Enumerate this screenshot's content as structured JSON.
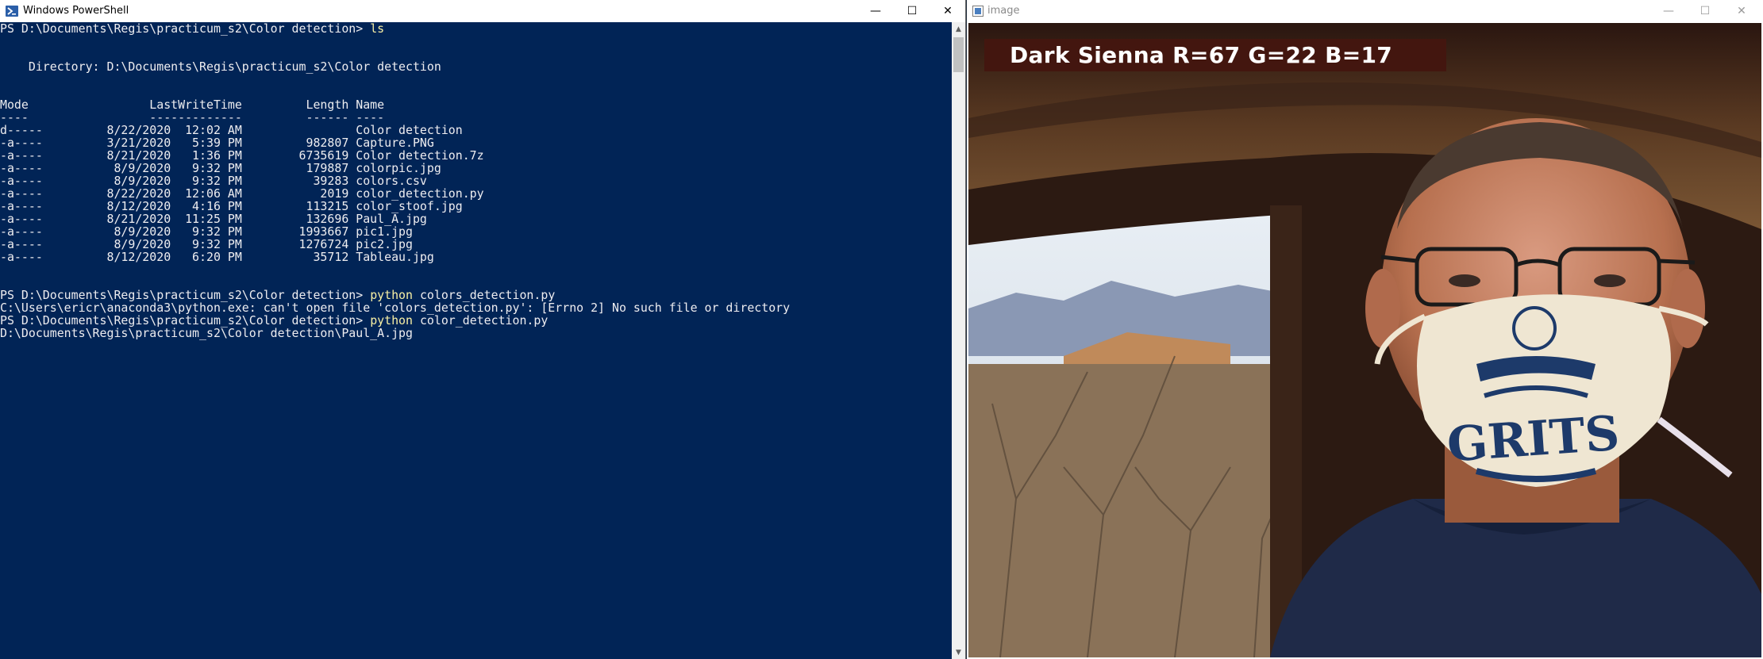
{
  "powershell": {
    "title": "Windows PowerShell",
    "lines": [
      {
        "prompt": "PS D:\\Documents\\Regis\\practicum_s2\\Color detection> ",
        "cmd": "ls",
        "rest": ""
      },
      {
        "text": ""
      },
      {
        "text": ""
      },
      {
        "text": "    Directory: D:\\Documents\\Regis\\practicum_s2\\Color detection"
      },
      {
        "text": ""
      },
      {
        "text": ""
      },
      {
        "text": "Mode                 LastWriteTime         Length Name"
      },
      {
        "text": "----                 -------------         ------ ----"
      },
      {
        "text": "d-----         8/22/2020  12:02 AM                Color detection"
      },
      {
        "text": "-a----         3/21/2020   5:39 PM         982807 Capture.PNG"
      },
      {
        "text": "-a----         8/21/2020   1:36 PM        6735619 Color detection.7z"
      },
      {
        "text": "-a----          8/9/2020   9:32 PM         179887 colorpic.jpg"
      },
      {
        "text": "-a----          8/9/2020   9:32 PM          39283 colors.csv"
      },
      {
        "text": "-a----         8/22/2020  12:06 AM           2019 color_detection.py"
      },
      {
        "text": "-a----         8/12/2020   4:16 PM         113215 color_stoof.jpg"
      },
      {
        "text": "-a----         8/21/2020  11:25 PM         132696 Paul_A.jpg"
      },
      {
        "text": "-a----          8/9/2020   9:32 PM        1993667 pic1.jpg"
      },
      {
        "text": "-a----          8/9/2020   9:32 PM        1276724 pic2.jpg"
      },
      {
        "text": "-a----         8/12/2020   6:20 PM          35712 Tableau.jpg"
      },
      {
        "text": ""
      },
      {
        "text": ""
      },
      {
        "prompt": "PS D:\\Documents\\Regis\\practicum_s2\\Color detection> ",
        "cmd": "python",
        "rest": " colors_detection.py"
      },
      {
        "text": "C:\\Users\\ericr\\anaconda3\\python.exe: can't open file 'colors_detection.py': [Errno 2] No such file or directory"
      },
      {
        "prompt": "PS D:\\Documents\\Regis\\practicum_s2\\Color detection> ",
        "cmd": "python",
        "rest": " color_detection.py"
      },
      {
        "text": "D:\\Documents\\Regis\\practicum_s2\\Color detection\\Paul_A.jpg"
      }
    ]
  },
  "image_window": {
    "title": "image",
    "detected_color_label": "Dark Sienna R=67 G=22 B=17",
    "banner_color": "#43160f"
  },
  "window_controls": {
    "minimize": "—",
    "maximize": "☐",
    "close": "✕"
  }
}
